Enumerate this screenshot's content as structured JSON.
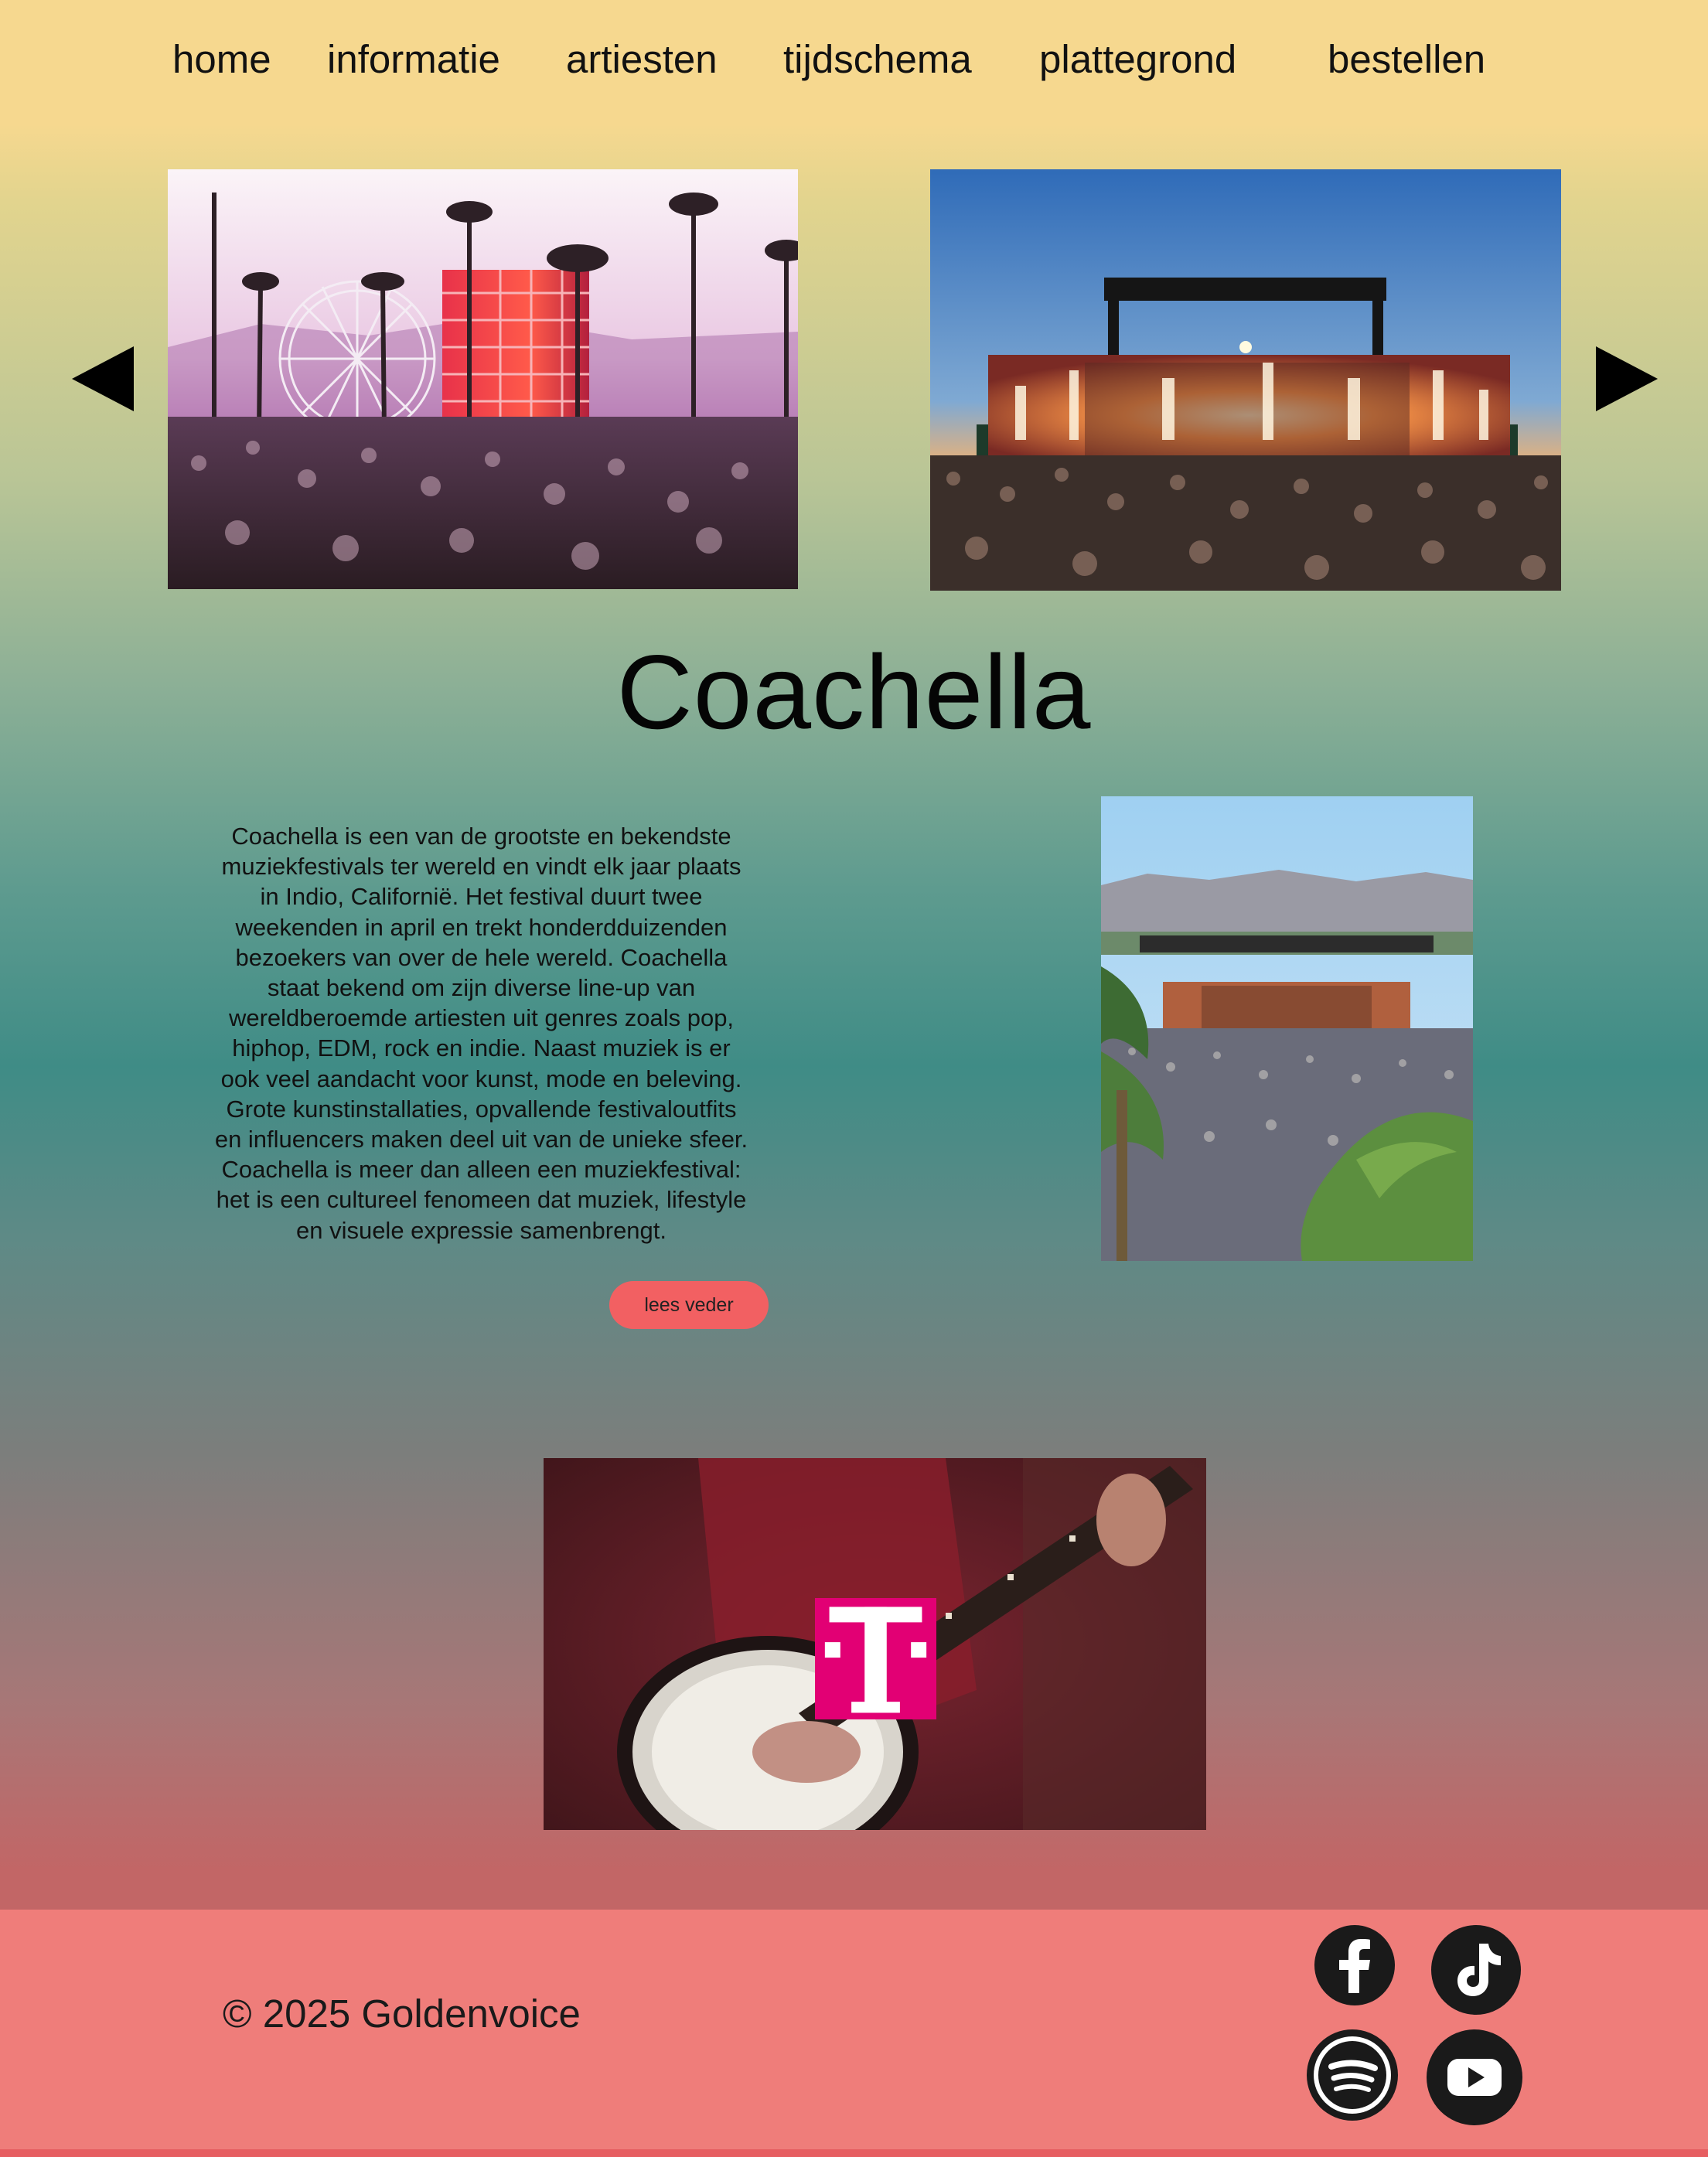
{
  "nav": {
    "items": [
      {
        "label": "home"
      },
      {
        "label": "informatie"
      },
      {
        "label": "artiesten"
      },
      {
        "label": "tijdschema"
      },
      {
        "label": "plattegrond"
      },
      {
        "label": "bestellen"
      }
    ]
  },
  "carousel": {
    "prev_icon": "triangle-left-icon",
    "next_icon": "triangle-right-icon"
  },
  "main": {
    "title": "Coachella",
    "paragraph_lines": [
      "Coachella is een van de grootste en bekendste",
      "muziekfestivals ter wereld en vindt elk jaar plaats",
      "in Indio, Californië. Het festival duurt twee",
      "weekenden in april en trekt honderdduizenden",
      "bezoekers van over de hele wereld. Coachella",
      "staat bekend om zijn diverse line-up van",
      "wereldberoemde artiesten uit genres zoals pop,",
      "hiphop, EDM, rock en indie. Naast muziek is er",
      "ook veel aandacht voor kunst, mode en beleving.",
      "Grote kunstinstallaties, opvallende festivaloutfits",
      "en influencers maken deel uit van de unieke sfeer.",
      "Coachella is meer dan alleen een muziekfestival:",
      "het is een cultureel fenomeen dat muziek, lifestyle",
      "en visuele expressie samenbrengt."
    ],
    "read_more_label": "lees veder"
  },
  "sponsor": {
    "logo_text": "T",
    "logo_color": "#e20074"
  },
  "footer": {
    "copyright": "© 2025 Goldenvoice",
    "social": [
      "facebook-icon",
      "tiktok-icon",
      "spotify-icon",
      "youtube-icon"
    ]
  },
  "colors": {
    "nav_bg": "#f6d88f",
    "button": "#f26062",
    "footer_bg": "#ef7d7a"
  }
}
